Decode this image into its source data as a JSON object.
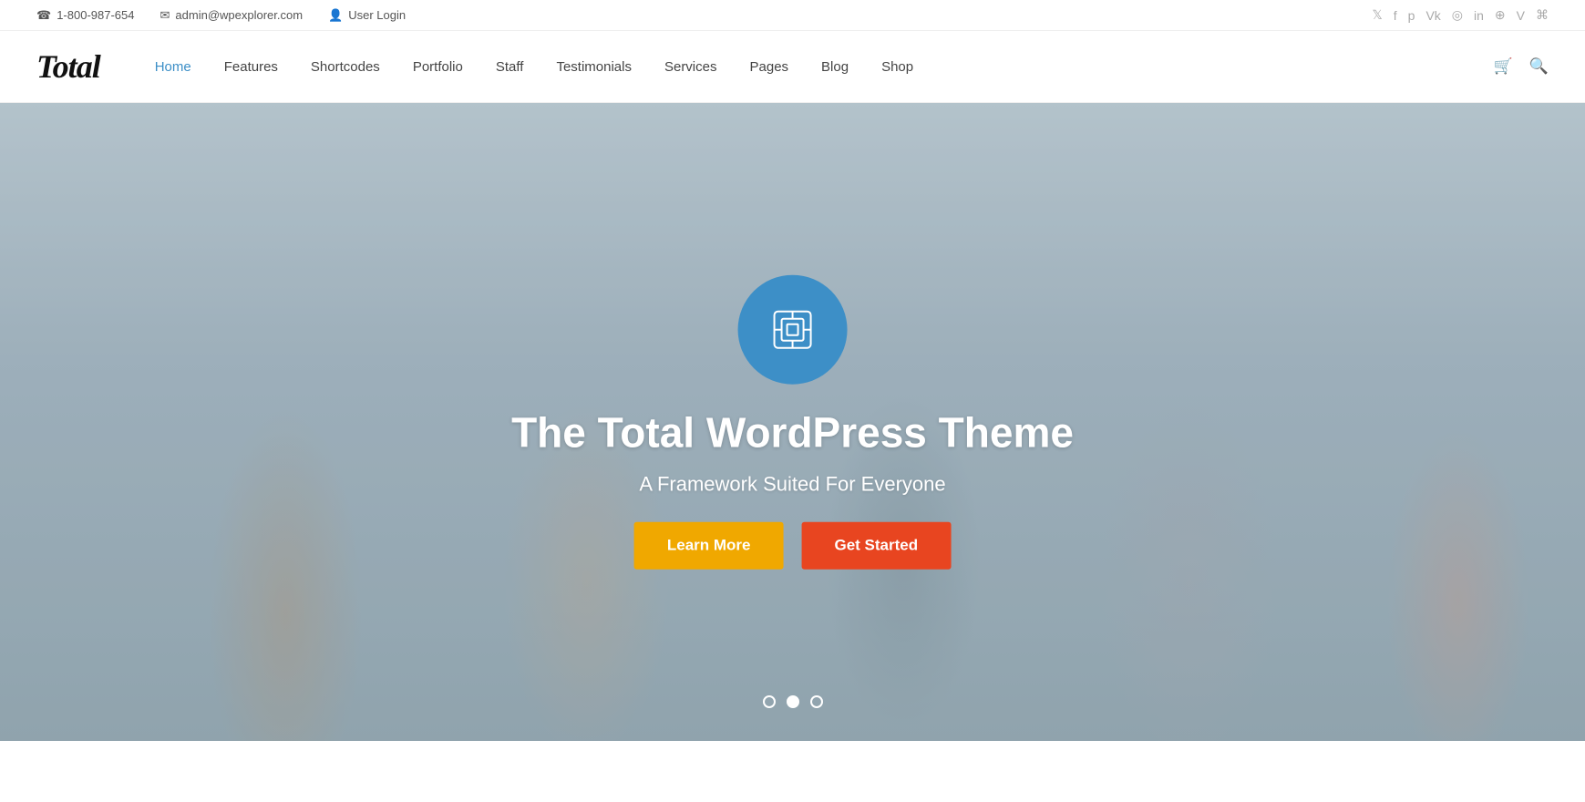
{
  "topbar": {
    "phone_icon": "☎",
    "phone": "1-800-987-654",
    "email_icon": "✉",
    "email": "admin@wpexplorer.com",
    "user_icon": "👤",
    "user_login": "User Login",
    "social_icons": [
      "𝕋",
      "f",
      "𝕡",
      "Vk",
      "📷",
      "in",
      "☁",
      "V",
      "☰"
    ]
  },
  "header": {
    "logo": "Total",
    "nav": [
      {
        "label": "Home",
        "active": true
      },
      {
        "label": "Features",
        "active": false
      },
      {
        "label": "Shortcodes",
        "active": false
      },
      {
        "label": "Portfolio",
        "active": false
      },
      {
        "label": "Staff",
        "active": false
      },
      {
        "label": "Testimonials",
        "active": false
      },
      {
        "label": "Services",
        "active": false
      },
      {
        "label": "Pages",
        "active": false
      },
      {
        "label": "Blog",
        "active": false
      },
      {
        "label": "Shop",
        "active": false
      }
    ],
    "cart_icon": "🛒",
    "search_icon": "🔍"
  },
  "hero": {
    "title": "The Total WordPress Theme",
    "subtitle": "A Framework Suited For Everyone",
    "btn_learn_more": "Learn More",
    "btn_get_started": "Get Started",
    "dots": [
      1,
      2,
      3
    ],
    "active_dot": 2
  }
}
